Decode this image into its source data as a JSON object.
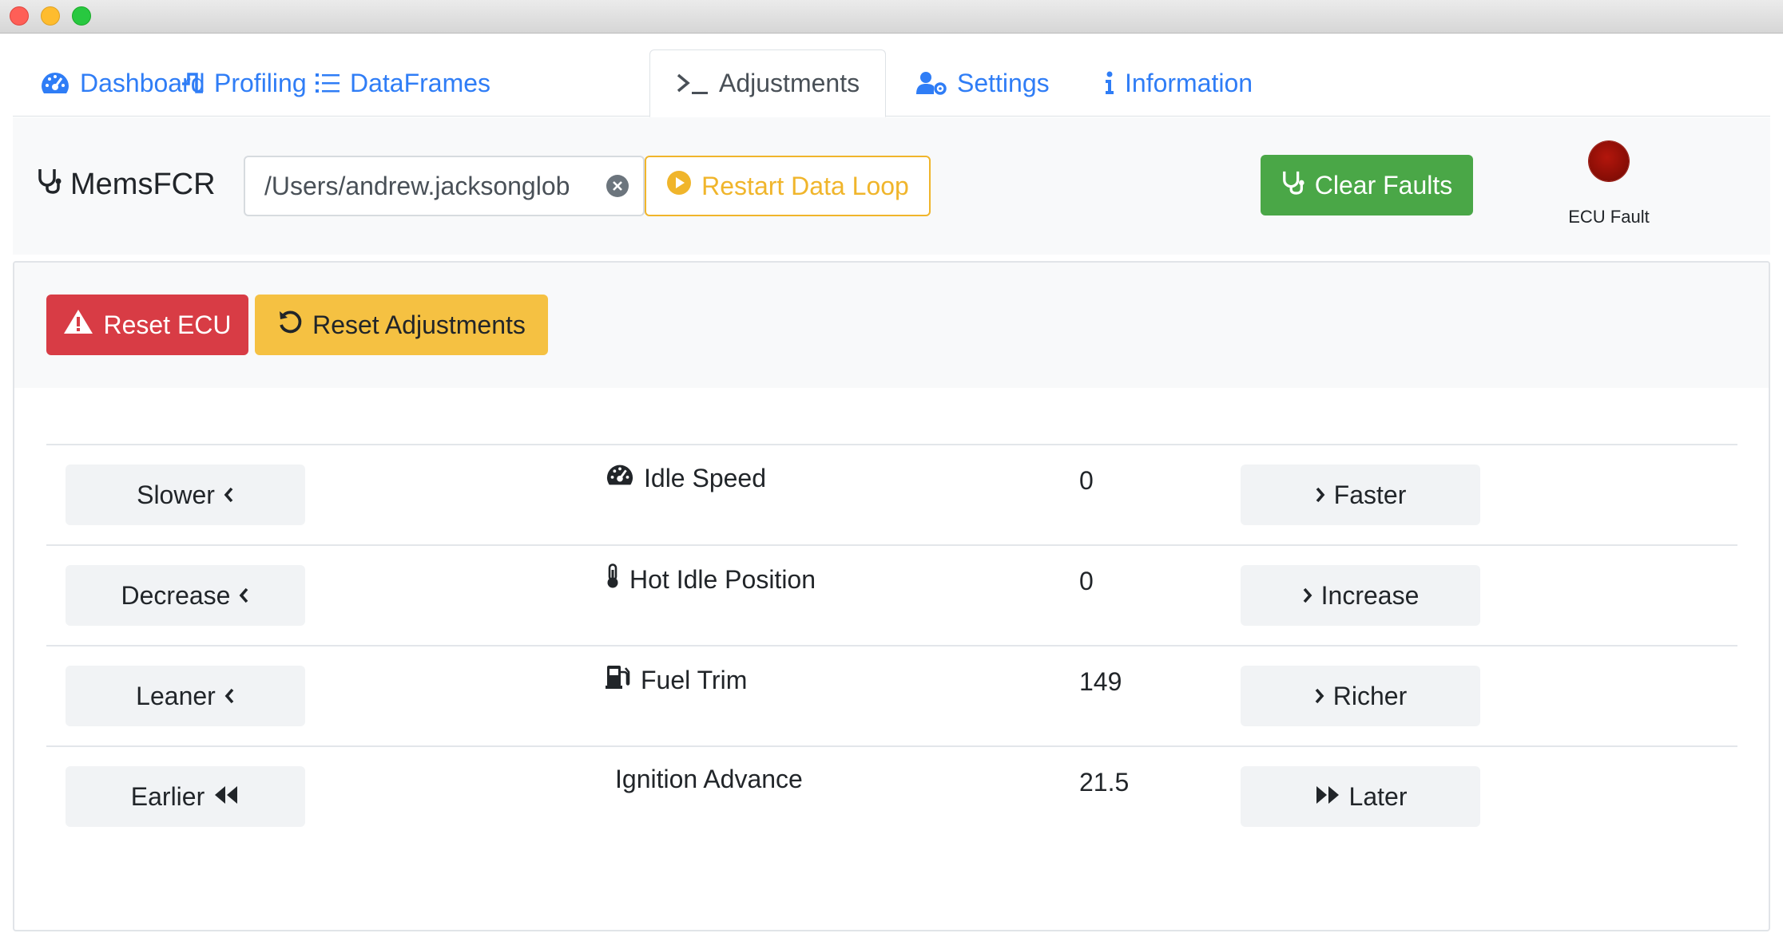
{
  "window": {
    "controls": [
      "close",
      "minimize",
      "zoom"
    ]
  },
  "tabs": [
    {
      "label": "Dashboard",
      "icon": "tachometer-icon",
      "active": false
    },
    {
      "label": "Profiling",
      "icon": "pulse-icon",
      "active": false
    },
    {
      "label": "DataFrames",
      "icon": "list-icon",
      "active": false
    },
    {
      "label": "Adjustments",
      "icon": "terminal-icon",
      "active": true
    },
    {
      "label": "Settings",
      "icon": "user-cog-icon",
      "active": false
    },
    {
      "label": "Information",
      "icon": "info-icon",
      "active": false
    }
  ],
  "toolbar": {
    "brand": "MemsFCR",
    "port_value": "/Users/andrew.jacksonglob",
    "restart_label": "Restart Data Loop",
    "clear_faults_label": "Clear Faults",
    "ecu_fault_label": "ECU Fault",
    "colors": {
      "warning": "#f0b52b",
      "success": "#4aa747",
      "fault_led": "#8c0e06",
      "link": "#2f7df6"
    }
  },
  "actions": {
    "reset_ecu_label": "Reset ECU",
    "reset_adjustments_label": "Reset Adjustments",
    "colors": {
      "danger": "#d83c45",
      "warning": "#f5c142"
    }
  },
  "adjustments": [
    {
      "decrease_label": "Slower",
      "decrease_icon": "chevron-left-icon",
      "name": "Idle Speed",
      "icon": "tachometer-icon",
      "value": "0",
      "increase_label": "Faster",
      "increase_icon": "chevron-right-icon"
    },
    {
      "decrease_label": "Decrease",
      "decrease_icon": "chevron-left-icon",
      "name": "Hot Idle Position",
      "icon": "thermometer-icon",
      "value": "0",
      "increase_label": "Increase",
      "increase_icon": "chevron-right-icon"
    },
    {
      "decrease_label": "Leaner",
      "decrease_icon": "chevron-left-icon",
      "name": "Fuel Trim",
      "icon": "gas-pump-icon",
      "value": "149",
      "increase_label": "Richer",
      "increase_icon": "chevron-right-icon"
    },
    {
      "decrease_label": "Earlier",
      "decrease_icon": "backward-icon",
      "name": "Ignition Advance",
      "icon": "",
      "value": "21.5",
      "increase_label": "Later",
      "increase_icon": "forward-icon"
    }
  ]
}
